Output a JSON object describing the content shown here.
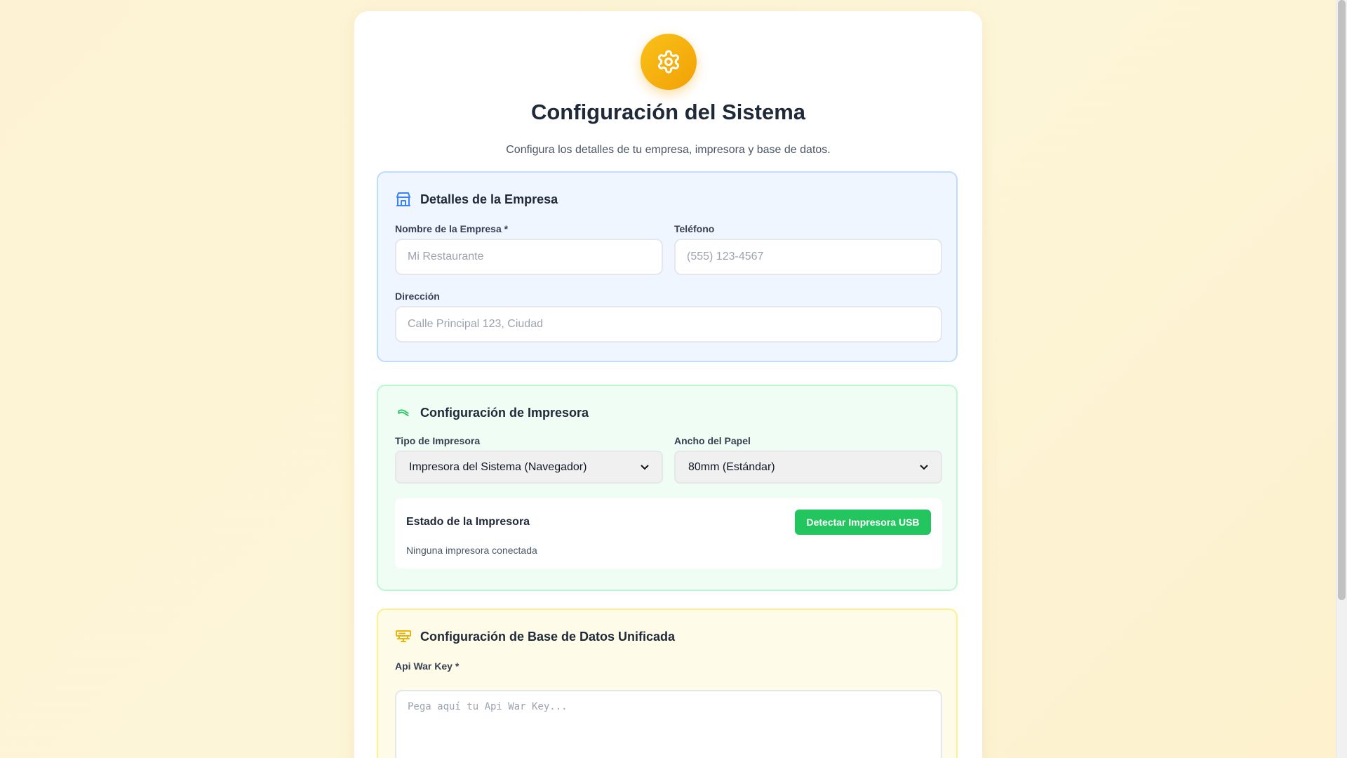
{
  "header": {
    "icon": "gear-icon",
    "title": "Configuración del Sistema",
    "subtitle": "Configura los detalles de tu empresa, impresora y base de datos."
  },
  "company": {
    "icon": "building-icon",
    "title": "Detalles de la Empresa",
    "name_label": "Nombre de la Empresa *",
    "name_placeholder": "Mi Restaurante",
    "phone_label": "Teléfono",
    "phone_placeholder": "(555) 123-4567",
    "address_label": "Dirección",
    "address_placeholder": "Calle Principal 123, Ciudad"
  },
  "printer": {
    "icon": "printer-icon",
    "title": "Configuración de Impresora",
    "type_label": "Tipo de Impresora",
    "type_value": "Impresora del Sistema (Navegador)",
    "paper_label": "Ancho del Papel",
    "paper_value": "80mm (Estándar)",
    "status_title": "Estado de la Impresora",
    "status_text": "Ninguna impresora conectada",
    "detect_button": "Detectar Impresora USB"
  },
  "database": {
    "icon": "server-icon",
    "title": "Configuración de Base de Datos Unificada",
    "key_label": "Api War Key *",
    "key_placeholder": "Pega aquí tu Api War Key..."
  },
  "colors": {
    "accent": "#f2a005",
    "primary_blue": "#3b82f6",
    "success_green": "#22c55e",
    "warning_yellow": "#eab308"
  }
}
